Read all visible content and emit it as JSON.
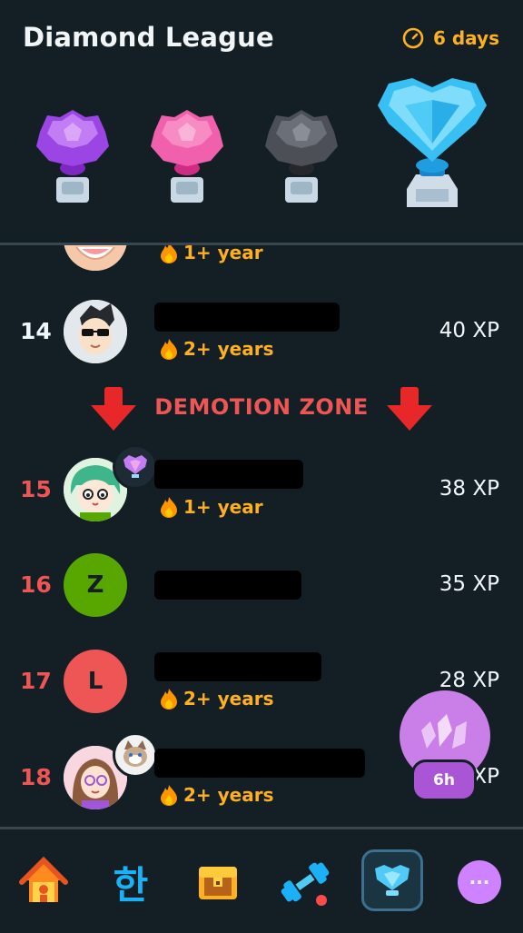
{
  "header": {
    "title": "Diamond League",
    "timer_label": "6 days"
  },
  "trophies": [
    {
      "name": "amethyst",
      "color": "#b15cf0"
    },
    {
      "name": "pearl",
      "color": "#f36fb8"
    },
    {
      "name": "obsidian",
      "color": "#5b5f66"
    },
    {
      "name": "diamond",
      "color": "#3fc6f6"
    }
  ],
  "leaderboard": {
    "partial_row": {
      "streak": "1+ year"
    },
    "rows": [
      {
        "rank": "14",
        "streak": "2+ years",
        "xp": "40 XP"
      },
      {
        "rank": "15",
        "streak": "1+ year",
        "xp": "38 XP"
      },
      {
        "rank": "16",
        "avatar_letter": "Z",
        "xp": "35 XP"
      },
      {
        "rank": "17",
        "avatar_letter": "L",
        "streak": "2+ years",
        "xp": "28 XP"
      },
      {
        "rank": "18",
        "streak": "2+ years",
        "xp": "XP"
      }
    ],
    "demotion_zone_label": "DEMOTION ZONE"
  },
  "fab": {
    "label": "6h"
  },
  "tabbar": {
    "korean_glyph": "한",
    "more_glyph": "···"
  },
  "colors": {
    "background": "#131f24",
    "streak": "#ffb020",
    "demotion": "#ee5555",
    "avatar_z": "#58a700",
    "avatar_l": "#ee5555"
  }
}
